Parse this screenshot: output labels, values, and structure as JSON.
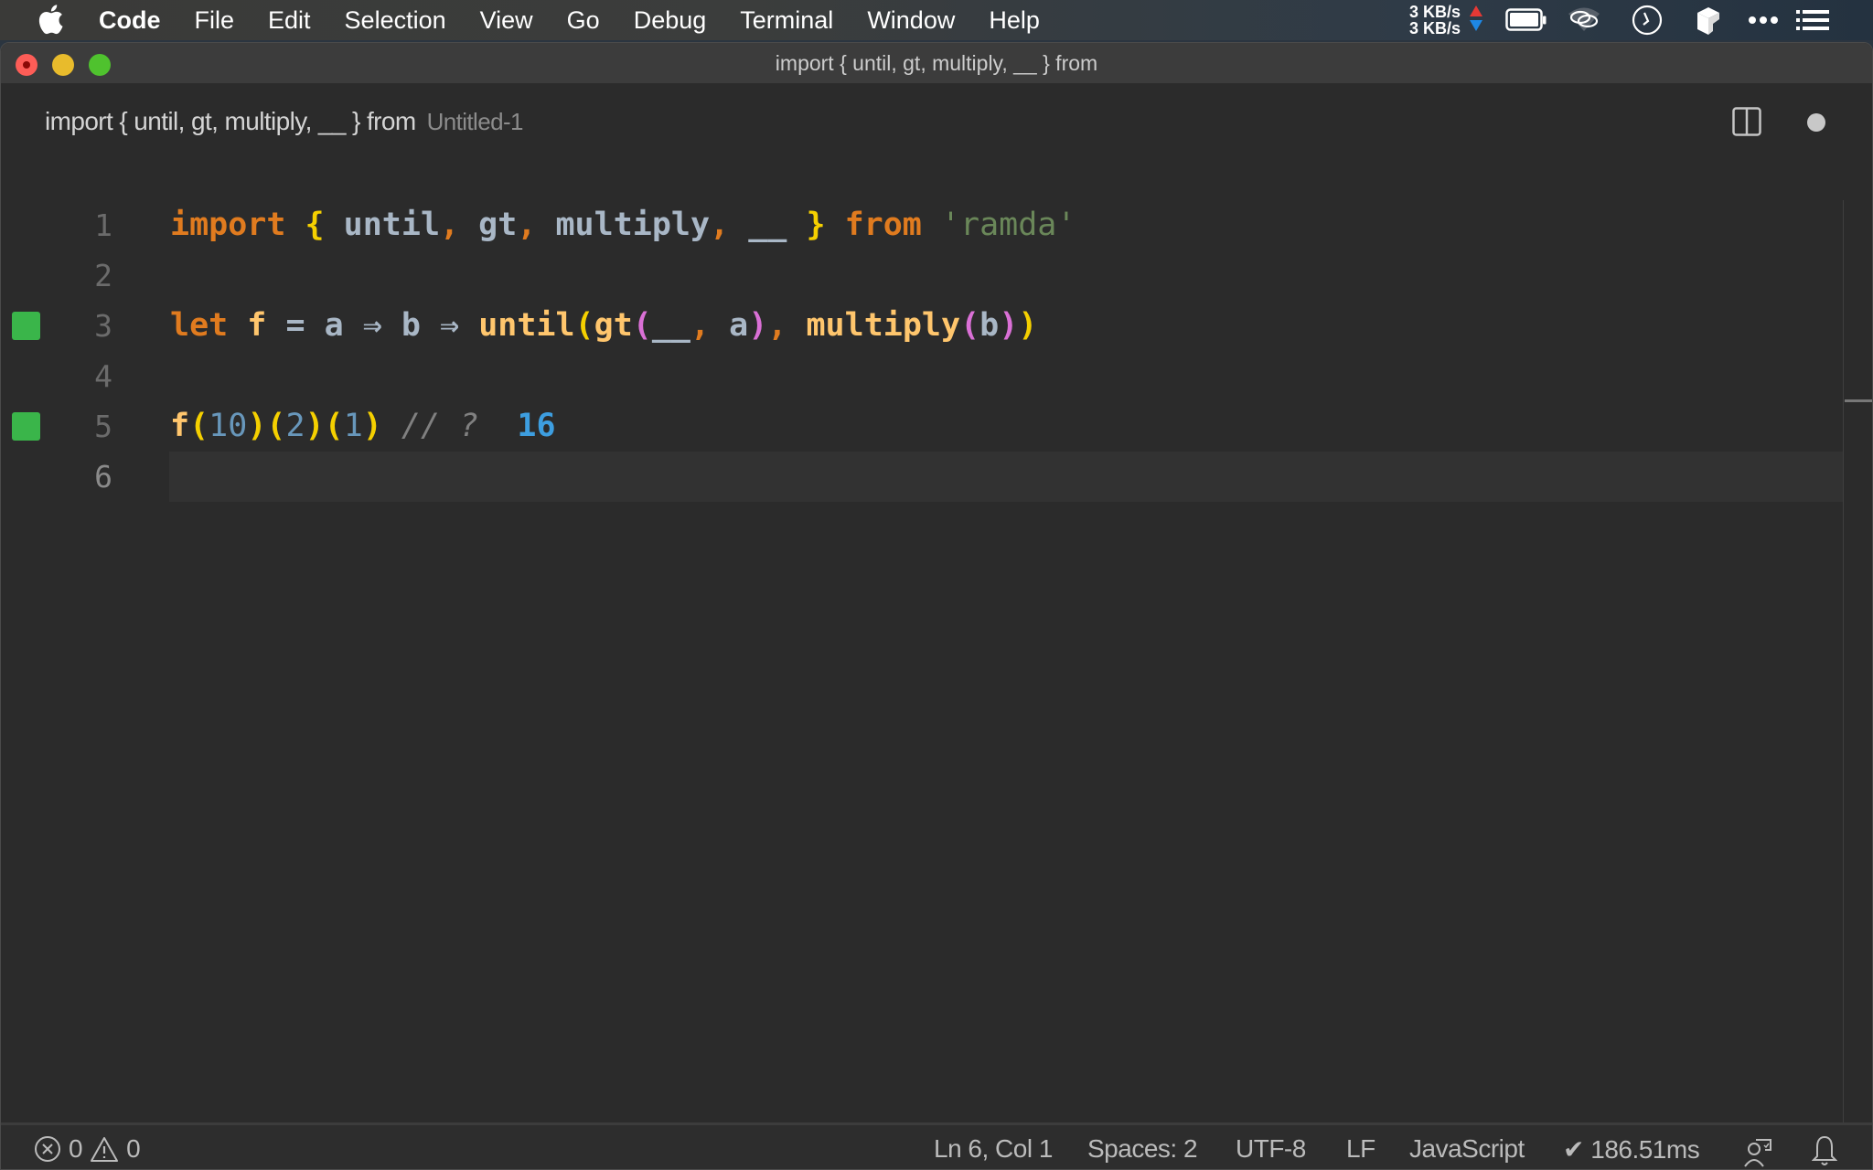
{
  "menubar": {
    "app_name": "Code",
    "items": [
      "File",
      "Edit",
      "Selection",
      "View",
      "Go",
      "Debug",
      "Terminal",
      "Window",
      "Help"
    ],
    "network": {
      "upload": "3 KB/s",
      "download": "3 KB/s"
    },
    "status_icons": [
      "battery-icon",
      "wifi-icon",
      "clock-icon",
      "cube-icon",
      "more-icon",
      "list-icon"
    ]
  },
  "window": {
    "title": "import { until, gt, multiply, __ } from"
  },
  "tab": {
    "title": "import { until, gt, multiply, __ } from",
    "description": "Untitled-1"
  },
  "editor": {
    "language": "JavaScript",
    "lines": [
      {
        "number": "1",
        "text": "import { until, gt, multiply, __ } from 'ramda'",
        "marker": false
      },
      {
        "number": "2",
        "text": "",
        "marker": false
      },
      {
        "number": "3",
        "text": "let f = a ⇒ b ⇒ until(gt(__, a), multiply(b))",
        "marker": true
      },
      {
        "number": "4",
        "text": "",
        "marker": false
      },
      {
        "number": "5",
        "text": "f(10)(2)(1) // ?  16",
        "marker": true
      },
      {
        "number": "6",
        "text": "",
        "marker": false
      }
    ],
    "tokens": {
      "l1": {
        "import": "import",
        "ob": "{",
        "until": " until",
        "c1": ",",
        "gt": " gt",
        "c2": ",",
        "multiply": " multiply",
        "c3": ",",
        "placeholder": " __ ",
        "cb": "}",
        "from": " from",
        "module": " 'ramda'"
      },
      "l3": {
        "let": "let",
        "f": " f",
        "eq": " = ",
        "a": "a",
        "arrow1": " ⇒ ",
        "b": "b",
        "arrow2": " ⇒ ",
        "until": "until",
        "p1": "(",
        "gt": "gt",
        "p2": "(",
        "ph": "__",
        "c": ",",
        "a2": " a",
        "p2c": ")",
        "c2": ",",
        "multiply": " multiply",
        "p3": "(",
        "b2": "b",
        "p3c": ")",
        "p1c": ")"
      },
      "l5": {
        "f": "f",
        "o1": "(",
        "n1": "10",
        "c1": ")",
        "o2": "(",
        "n2": "2",
        "c2": ")",
        "o3": "(",
        "n3": "1",
        "c3": ")",
        "comment": " // ?  ",
        "result": "16"
      }
    },
    "current_line": 6
  },
  "statusbar": {
    "errors": "0",
    "warnings": "0",
    "cursor": "Ln 6, Col 1",
    "indent": "Spaces: 2",
    "encoding": "UTF-8",
    "eol": "LF",
    "language": "JavaScript",
    "quokka": "✔ 186.51ms"
  }
}
